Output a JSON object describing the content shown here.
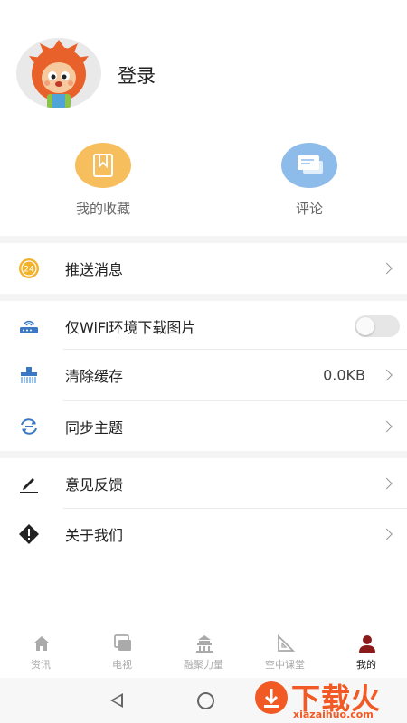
{
  "profile": {
    "login_label": "登录"
  },
  "quick_actions": [
    {
      "label": "我的收藏",
      "icon": "bookmark-icon",
      "color": "#f6be5c"
    },
    {
      "label": "评论",
      "icon": "chat-bubble-icon",
      "color": "#8dbbea"
    }
  ],
  "settings": {
    "push": {
      "label": "推送消息",
      "icon": "push-24-icon",
      "color": "#f2b22a"
    },
    "wifi_only": {
      "label": "仅WiFi环境下载图片",
      "icon": "router-icon",
      "enabled": false
    },
    "clear_cache": {
      "label": "清除缓存",
      "value": "0.0KB",
      "icon": "broom-icon"
    },
    "sync_theme": {
      "label": "同步主题",
      "icon": "sync-icon"
    },
    "feedback": {
      "label": "意见反馈",
      "icon": "pencil-icon"
    },
    "about": {
      "label": "关于我们",
      "icon": "warning-diamond-icon"
    }
  },
  "tabs": [
    {
      "label": "资讯",
      "icon": "home-icon",
      "active": false
    },
    {
      "label": "电视",
      "icon": "tv-icon",
      "active": false
    },
    {
      "label": "融聚力量",
      "icon": "temple-icon",
      "active": false
    },
    {
      "label": "空中课堂",
      "icon": "ruler-icon",
      "active": false
    },
    {
      "label": "我的",
      "icon": "user-icon",
      "active": true
    }
  ],
  "colors": {
    "active_tab": "#8b1a1a",
    "accent_blue": "#3b78c4"
  },
  "watermark": {
    "text": "下载火",
    "url": "xiazaihuo.com"
  }
}
